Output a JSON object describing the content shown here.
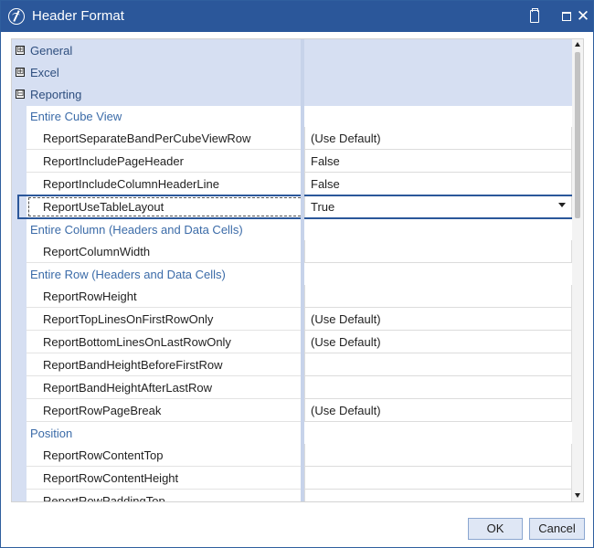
{
  "window": {
    "title": "Header Format",
    "icons": {
      "app": "app-logo-icon",
      "clipboard": "clipboard-icon",
      "maximize": "maximize-icon",
      "close": "close-icon"
    },
    "close_glyph": "✕"
  },
  "grid": {
    "categories": [
      {
        "label": "General",
        "expander": "⊞"
      },
      {
        "label": "Excel",
        "expander": "⊞"
      },
      {
        "label": "Reporting",
        "expander": "⊟"
      }
    ],
    "sections": {
      "entire_cube_view": "Entire Cube View",
      "entire_column": "Entire Column (Headers and Data Cells)",
      "entire_row": "Entire Row (Headers and Data Cells)",
      "position": "Position"
    },
    "properties": [
      {
        "name": "ReportSeparateBandPerCubeViewRow",
        "value": "(Use Default)"
      },
      {
        "name": "ReportIncludePageHeader",
        "value": "False"
      },
      {
        "name": "ReportIncludeColumnHeaderLine",
        "value": "False"
      },
      {
        "name": "ReportUseTableLayout",
        "value": "True"
      },
      {
        "name": "ReportColumnWidth",
        "value": ""
      },
      {
        "name": "ReportRowHeight",
        "value": ""
      },
      {
        "name": "ReportTopLinesOnFirstRowOnly",
        "value": "(Use Default)"
      },
      {
        "name": "ReportBottomLinesOnLastRowOnly",
        "value": "(Use Default)"
      },
      {
        "name": "ReportBandHeightBeforeFirstRow",
        "value": ""
      },
      {
        "name": "ReportBandHeightAfterLastRow",
        "value": ""
      },
      {
        "name": "ReportRowPageBreak",
        "value": "(Use Default)"
      },
      {
        "name": "ReportRowContentTop",
        "value": ""
      },
      {
        "name": "ReportRowContentHeight",
        "value": ""
      },
      {
        "name": "ReportRowPaddingTop",
        "value": ""
      }
    ],
    "selected_property": "ReportUseTableLayout",
    "dropdown_icon": "chevron-down-icon"
  },
  "scrollbar": {
    "up_icon": "scroll-up-arrow-icon",
    "down_icon": "scroll-down-arrow-icon"
  },
  "footer": {
    "ok_label": "OK",
    "cancel_label": "Cancel"
  },
  "colors": {
    "title_bar": "#2b579a",
    "category_background": "#d6dff2",
    "section_text": "#3b6ba8",
    "selection_border": "#2b579a",
    "button_background": "#dfe7f5"
  }
}
